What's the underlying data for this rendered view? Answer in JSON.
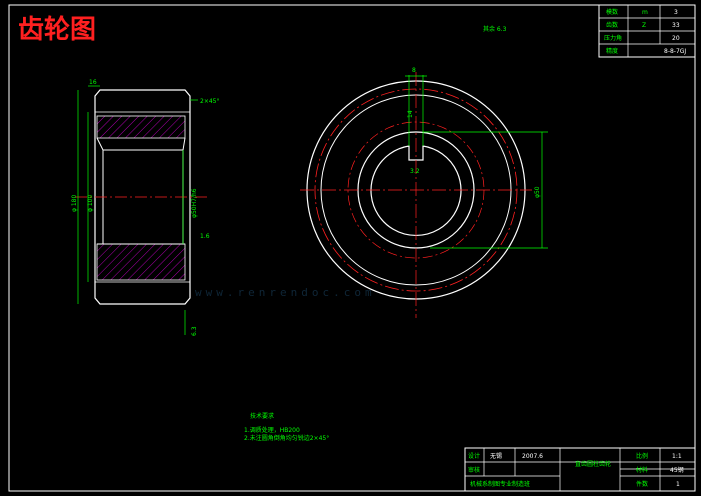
{
  "title": "齿轮图",
  "roughness_note": "其余 6.3",
  "param_table": {
    "rows": [
      {
        "label": "模数",
        "sym": "m",
        "value": "3"
      },
      {
        "label": "齿数",
        "sym": "Z",
        "value": "33"
      },
      {
        "label": "压力角",
        "sym": "",
        "value": "20"
      },
      {
        "label": "精度",
        "sym": "",
        "value": "8-8-7GJ"
      }
    ]
  },
  "dimensions": {
    "width_top": "16",
    "chamfer": "2×45°",
    "dia_outer": "φ 180",
    "dia_root": "φ 100",
    "bore_fit": "φ50H7/h6",
    "rough_1": "1.6",
    "rough_2": "6.3",
    "key_width": "8",
    "key_depth": "14",
    "rough_key": "3.2",
    "hub_dia": "φ50"
  },
  "tech_req": {
    "title": "技术要求",
    "items": [
      "1.调质处理，HB200",
      "2.未注圆角倒角均匀锐边2×45°"
    ]
  },
  "title_block": {
    "design_label": "设计",
    "designer": "无锡",
    "date": "2007.6",
    "part_name": "直齿圆柱齿轮",
    "check_label": "审核",
    "scale_label": "比例",
    "scale_value": "1:1",
    "material_label": "材料",
    "material_value": "45钢",
    "school": "机械系制图专业制造班",
    "qty_label": "件数",
    "qty_value": "1"
  },
  "watermark": "www.renrendoc.com"
}
